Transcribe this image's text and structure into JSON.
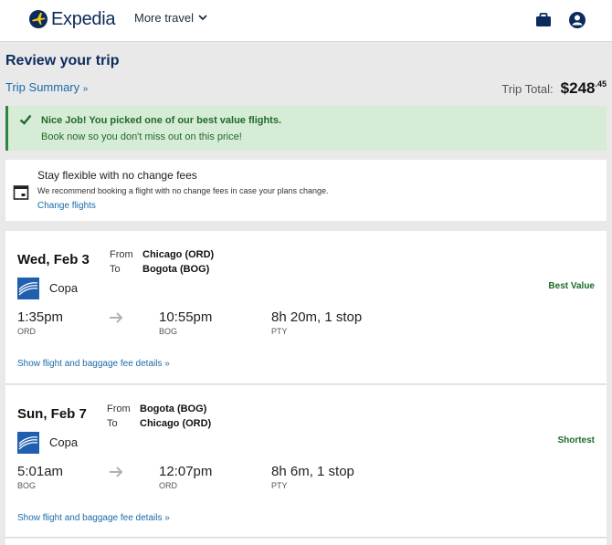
{
  "header": {
    "brand": "Expedia",
    "more_travel": "More travel",
    "icons": {
      "bag": "briefcase-icon",
      "account": "account-icon"
    },
    "brand_color": "#0b2b5b"
  },
  "page": {
    "title": "Review your trip",
    "trip_summary": "Trip Summary",
    "trip_total_label": "Trip Total:",
    "trip_total_amount": "$248",
    "trip_total_cents": ".45"
  },
  "alert": {
    "title": "Nice Job! You picked one of our best value flights.",
    "subtitle": "Book now so you don't miss out on this price!",
    "color": "#2e8540"
  },
  "flex": {
    "title": "Stay flexible with no change fees",
    "description": "We recommend booking a flight with no change fees in case your plans change.",
    "link": "Change flights"
  },
  "flights": [
    {
      "date": "Wed, Feb 3",
      "from_label": "From",
      "to_label": "To",
      "from": "Chicago (ORD)",
      "to": "Bogota (BOG)",
      "airline": "Copa",
      "badge": "Best Value",
      "depart_time": "1:35pm",
      "depart_code": "ORD",
      "arrive_time": "10:55pm",
      "arrive_code": "BOG",
      "duration": "8h 20m, 1 stop",
      "stop_code": "PTY",
      "details_link": "Show flight and baggage fee details"
    },
    {
      "date": "Sun, Feb 7",
      "from_label": "From",
      "to_label": "To",
      "from": "Bogota (BOG)",
      "to": "Chicago (ORD)",
      "airline": "Copa",
      "badge": "Shortest",
      "depart_time": "5:01am",
      "depart_code": "BOG",
      "arrive_time": "12:07pm",
      "arrive_code": "ORD",
      "duration": "8h 6m, 1 stop",
      "stop_code": "PTY",
      "details_link": "Show flight and baggage fee details"
    }
  ]
}
